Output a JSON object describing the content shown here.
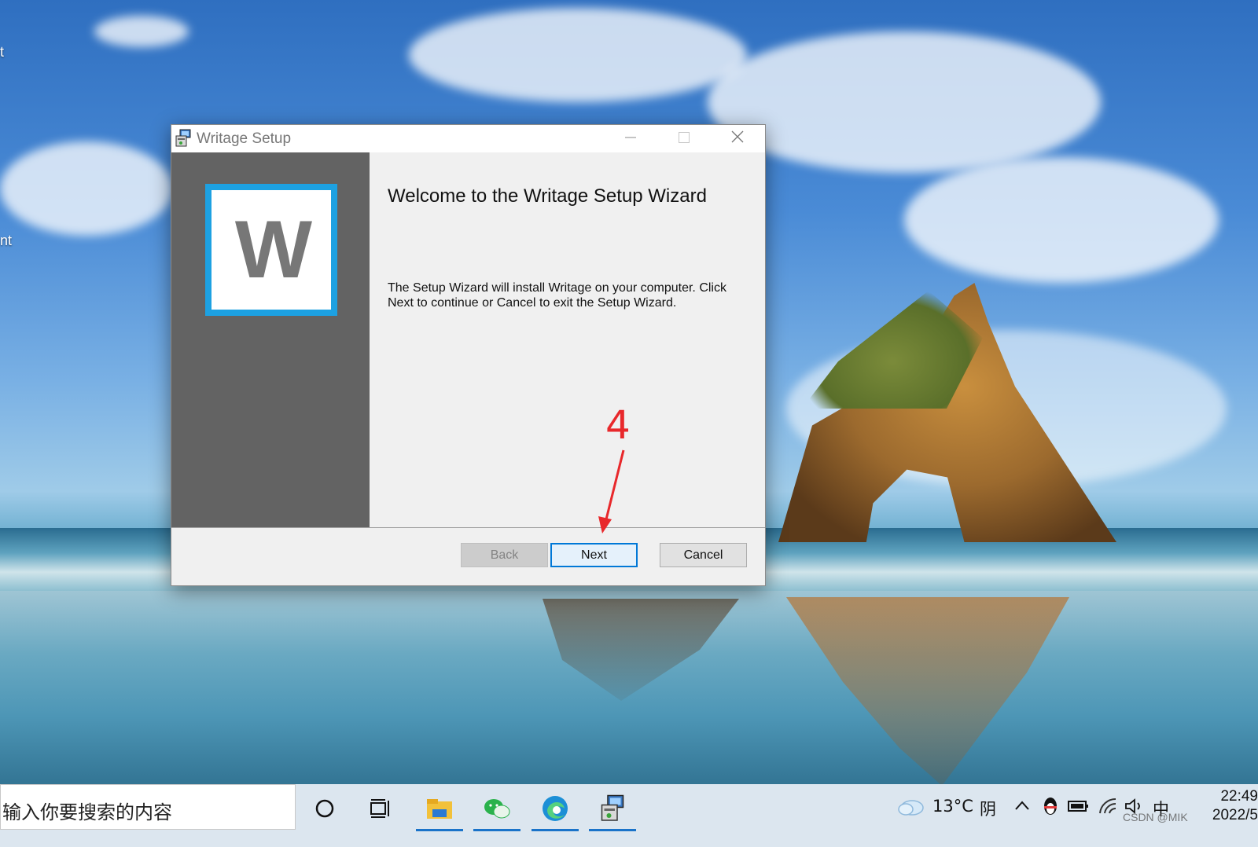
{
  "window": {
    "title": "Writage Setup",
    "icon": "installer-icon",
    "controls": [
      "minimize-icon",
      "maximize-icon",
      "close-icon"
    ]
  },
  "wizard": {
    "logo_letter": "W",
    "heading": "Welcome to the Writage Setup Wizard",
    "description": "The Setup Wizard will install Writage on your computer. Click Next to continue or Cancel to exit the Setup Wizard."
  },
  "buttons": {
    "back": "Back",
    "next": "Next",
    "cancel": "Cancel"
  },
  "annotation": {
    "step_number": "4",
    "color": "#e8282b"
  },
  "desktop_edge": {
    "left_text_1": "t",
    "left_text_2": "nt"
  },
  "taskbar": {
    "search_placeholder": "输入你要搜索的内容",
    "pinned": [
      "cortana-icon",
      "task-view-icon",
      "file-explorer-icon",
      "wechat-icon",
      "edge-icon",
      "installer-icon"
    ],
    "weather_temp": "13°C",
    "weather_text": "阴",
    "ime": "中",
    "time": "22:49",
    "date": "2022/5",
    "watermark": "CSDN @MIK"
  },
  "colors": {
    "accent": "#0078d7",
    "logo_border": "#1da1e2",
    "side_panel": "#636363"
  }
}
